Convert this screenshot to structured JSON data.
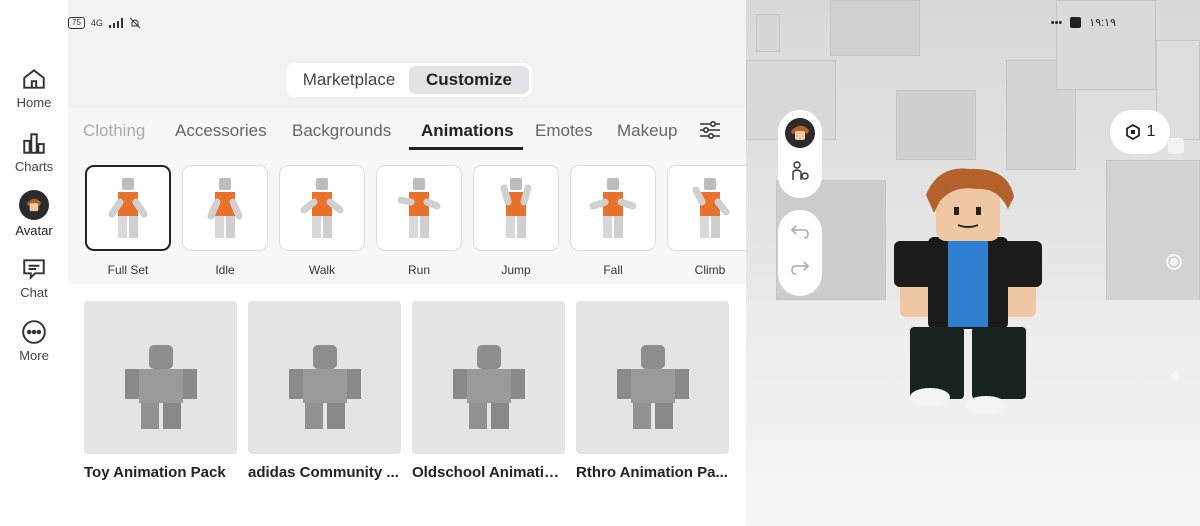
{
  "status": {
    "battery": "75",
    "network": "4G",
    "time": "١٩:١٩"
  },
  "nav": {
    "items": [
      {
        "label": "Home",
        "icon": "home-icon"
      },
      {
        "label": "Charts",
        "icon": "charts-icon"
      },
      {
        "label": "Avatar",
        "icon": "avatar-icon"
      },
      {
        "label": "Chat",
        "icon": "chat-icon"
      },
      {
        "label": "More",
        "icon": "more-icon"
      }
    ]
  },
  "segment": {
    "marketplace": "Marketplace",
    "customize": "Customize",
    "active": "Customize"
  },
  "tabs": [
    "Clothing",
    "Accessories",
    "Backgrounds",
    "Animations",
    "Emotes",
    "Makeup"
  ],
  "active_tab": "Animations",
  "animation_types": [
    "Full Set",
    "Idle",
    "Walk",
    "Run",
    "Jump",
    "Fall",
    "Climb"
  ],
  "selected_animation": "Full Set",
  "packs": [
    "Toy Animation Pack",
    "adidas Community ...",
    "Oldschool Animatio...",
    "Rthro Animation Pa..."
  ],
  "robux": {
    "count": "1"
  },
  "colors": {
    "accent_orange": "#e8722c",
    "selected_border": "#222222",
    "tab_bg": "#f7f7f7"
  }
}
